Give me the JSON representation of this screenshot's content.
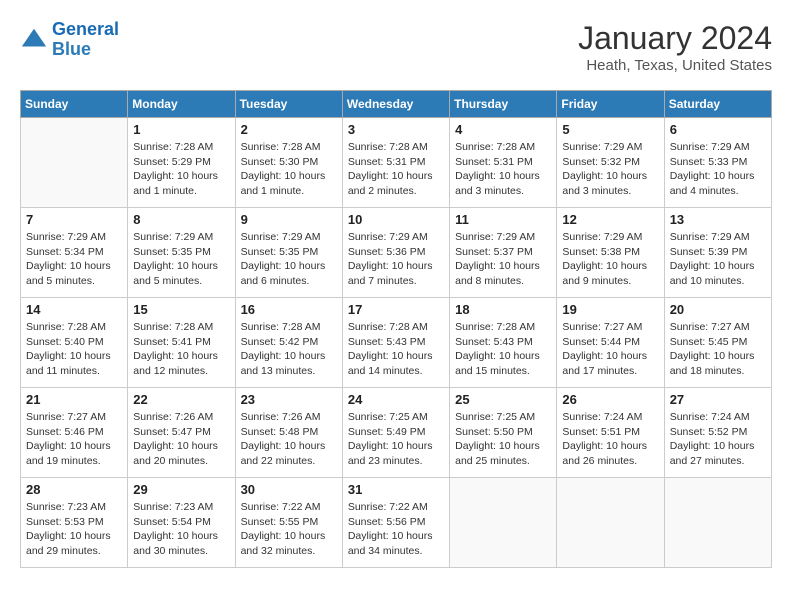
{
  "header": {
    "logo_line1": "General",
    "logo_line2": "Blue",
    "title": "January 2024",
    "subtitle": "Heath, Texas, United States"
  },
  "days_of_week": [
    "Sunday",
    "Monday",
    "Tuesday",
    "Wednesday",
    "Thursday",
    "Friday",
    "Saturday"
  ],
  "weeks": [
    [
      {
        "day": "",
        "info": ""
      },
      {
        "day": "1",
        "info": "Sunrise: 7:28 AM\nSunset: 5:29 PM\nDaylight: 10 hours\nand 1 minute."
      },
      {
        "day": "2",
        "info": "Sunrise: 7:28 AM\nSunset: 5:30 PM\nDaylight: 10 hours\nand 1 minute."
      },
      {
        "day": "3",
        "info": "Sunrise: 7:28 AM\nSunset: 5:31 PM\nDaylight: 10 hours\nand 2 minutes."
      },
      {
        "day": "4",
        "info": "Sunrise: 7:28 AM\nSunset: 5:31 PM\nDaylight: 10 hours\nand 3 minutes."
      },
      {
        "day": "5",
        "info": "Sunrise: 7:29 AM\nSunset: 5:32 PM\nDaylight: 10 hours\nand 3 minutes."
      },
      {
        "day": "6",
        "info": "Sunrise: 7:29 AM\nSunset: 5:33 PM\nDaylight: 10 hours\nand 4 minutes."
      }
    ],
    [
      {
        "day": "7",
        "info": "Sunrise: 7:29 AM\nSunset: 5:34 PM\nDaylight: 10 hours\nand 5 minutes."
      },
      {
        "day": "8",
        "info": "Sunrise: 7:29 AM\nSunset: 5:35 PM\nDaylight: 10 hours\nand 5 minutes."
      },
      {
        "day": "9",
        "info": "Sunrise: 7:29 AM\nSunset: 5:35 PM\nDaylight: 10 hours\nand 6 minutes."
      },
      {
        "day": "10",
        "info": "Sunrise: 7:29 AM\nSunset: 5:36 PM\nDaylight: 10 hours\nand 7 minutes."
      },
      {
        "day": "11",
        "info": "Sunrise: 7:29 AM\nSunset: 5:37 PM\nDaylight: 10 hours\nand 8 minutes."
      },
      {
        "day": "12",
        "info": "Sunrise: 7:29 AM\nSunset: 5:38 PM\nDaylight: 10 hours\nand 9 minutes."
      },
      {
        "day": "13",
        "info": "Sunrise: 7:29 AM\nSunset: 5:39 PM\nDaylight: 10 hours\nand 10 minutes."
      }
    ],
    [
      {
        "day": "14",
        "info": "Sunrise: 7:28 AM\nSunset: 5:40 PM\nDaylight: 10 hours\nand 11 minutes."
      },
      {
        "day": "15",
        "info": "Sunrise: 7:28 AM\nSunset: 5:41 PM\nDaylight: 10 hours\nand 12 minutes."
      },
      {
        "day": "16",
        "info": "Sunrise: 7:28 AM\nSunset: 5:42 PM\nDaylight: 10 hours\nand 13 minutes."
      },
      {
        "day": "17",
        "info": "Sunrise: 7:28 AM\nSunset: 5:43 PM\nDaylight: 10 hours\nand 14 minutes."
      },
      {
        "day": "18",
        "info": "Sunrise: 7:28 AM\nSunset: 5:43 PM\nDaylight: 10 hours\nand 15 minutes."
      },
      {
        "day": "19",
        "info": "Sunrise: 7:27 AM\nSunset: 5:44 PM\nDaylight: 10 hours\nand 17 minutes."
      },
      {
        "day": "20",
        "info": "Sunrise: 7:27 AM\nSunset: 5:45 PM\nDaylight: 10 hours\nand 18 minutes."
      }
    ],
    [
      {
        "day": "21",
        "info": "Sunrise: 7:27 AM\nSunset: 5:46 PM\nDaylight: 10 hours\nand 19 minutes."
      },
      {
        "day": "22",
        "info": "Sunrise: 7:26 AM\nSunset: 5:47 PM\nDaylight: 10 hours\nand 20 minutes."
      },
      {
        "day": "23",
        "info": "Sunrise: 7:26 AM\nSunset: 5:48 PM\nDaylight: 10 hours\nand 22 minutes."
      },
      {
        "day": "24",
        "info": "Sunrise: 7:25 AM\nSunset: 5:49 PM\nDaylight: 10 hours\nand 23 minutes."
      },
      {
        "day": "25",
        "info": "Sunrise: 7:25 AM\nSunset: 5:50 PM\nDaylight: 10 hours\nand 25 minutes."
      },
      {
        "day": "26",
        "info": "Sunrise: 7:24 AM\nSunset: 5:51 PM\nDaylight: 10 hours\nand 26 minutes."
      },
      {
        "day": "27",
        "info": "Sunrise: 7:24 AM\nSunset: 5:52 PM\nDaylight: 10 hours\nand 27 minutes."
      }
    ],
    [
      {
        "day": "28",
        "info": "Sunrise: 7:23 AM\nSunset: 5:53 PM\nDaylight: 10 hours\nand 29 minutes."
      },
      {
        "day": "29",
        "info": "Sunrise: 7:23 AM\nSunset: 5:54 PM\nDaylight: 10 hours\nand 30 minutes."
      },
      {
        "day": "30",
        "info": "Sunrise: 7:22 AM\nSunset: 5:55 PM\nDaylight: 10 hours\nand 32 minutes."
      },
      {
        "day": "31",
        "info": "Sunrise: 7:22 AM\nSunset: 5:56 PM\nDaylight: 10 hours\nand 34 minutes."
      },
      {
        "day": "",
        "info": ""
      },
      {
        "day": "",
        "info": ""
      },
      {
        "day": "",
        "info": ""
      }
    ]
  ]
}
